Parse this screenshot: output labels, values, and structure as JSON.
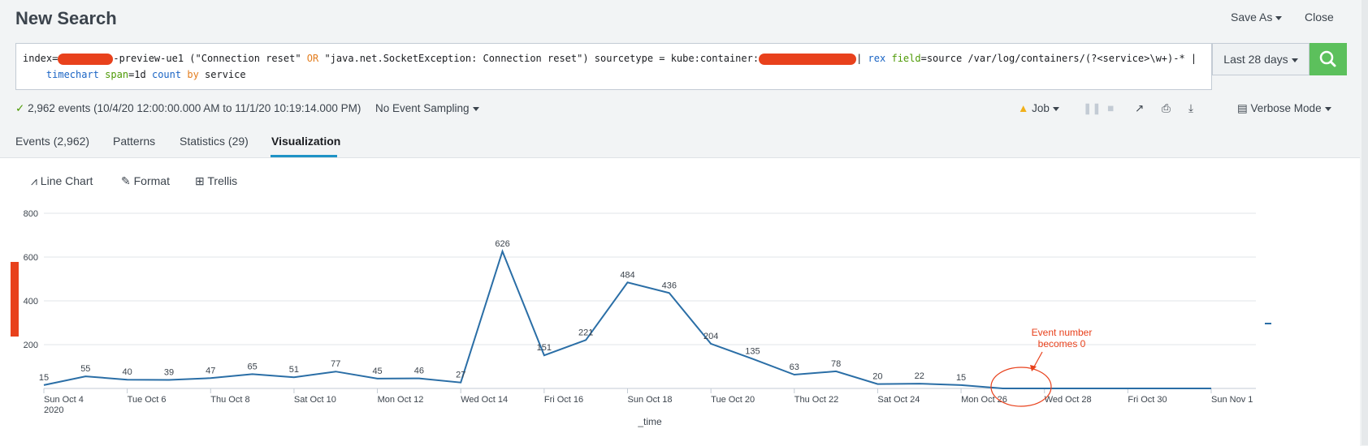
{
  "header": {
    "title": "New Search",
    "save_as_label": "Save As",
    "close_label": "Close"
  },
  "search": {
    "query_parts": {
      "p1": "index=",
      "p2": "-preview-ue1 (\"Connection reset\" ",
      "or": "OR",
      "p3": " \"java.net.SocketException: Connection reset\") sourcetype = kube:container:",
      "pipe1": "| ",
      "rex": "rex",
      "sp": " ",
      "field": "field",
      "p4": "=source /var/log/containers/(?<service>\\w+)-* |",
      "indent": "    ",
      "timechart": "timechart",
      "sp2": " ",
      "span": "span",
      "p5": "=1d ",
      "count": "count",
      "sp3": " ",
      "by": "by",
      "p6": " service"
    },
    "time_range_label": "Last 28 days"
  },
  "status_bar": {
    "events_summary": "2,962 events (10/4/20 12:00:00.000 AM to 11/1/20 10:19:14.000 PM)",
    "sampling_label": "No Event Sampling",
    "job_label": "Job",
    "mode_label": "Verbose Mode"
  },
  "tabs": [
    {
      "label": "Events (2,962)"
    },
    {
      "label": "Patterns"
    },
    {
      "label": "Statistics (29)"
    },
    {
      "label": "Visualization"
    }
  ],
  "viz_toolbar": {
    "line_chart_label": "Line Chart",
    "format_label": "Format",
    "trellis_label": "Trellis"
  },
  "annotation": {
    "line1": "Event number",
    "line2": "becomes 0"
  },
  "colors": {
    "accent_blue": "#2a6ea6",
    "go_green": "#5cc05c",
    "annotation_red": "#e8411c",
    "tab_underline": "#1e93c6"
  },
  "chart_data": {
    "type": "line",
    "xlabel": "_time",
    "ylabel": "",
    "ylim": [
      0,
      800
    ],
    "y_ticks": [
      200,
      400,
      600,
      800
    ],
    "x": [
      "2020-10-04",
      "2020-10-05",
      "2020-10-06",
      "2020-10-07",
      "2020-10-08",
      "2020-10-09",
      "2020-10-10",
      "2020-10-11",
      "2020-10-12",
      "2020-10-13",
      "2020-10-14",
      "2020-10-15",
      "2020-10-16",
      "2020-10-17",
      "2020-10-18",
      "2020-10-19",
      "2020-10-20",
      "2020-10-21",
      "2020-10-22",
      "2020-10-23",
      "2020-10-24",
      "2020-10-25",
      "2020-10-26",
      "2020-10-27",
      "2020-10-28",
      "2020-10-29",
      "2020-10-30",
      "2020-10-31",
      "2020-11-01"
    ],
    "x_tick_labels": [
      "Sun Oct 4",
      "Tue Oct 6",
      "Thu Oct 8",
      "Sat Oct 10",
      "Mon Oct 12",
      "Wed Oct 14",
      "Fri Oct 16",
      "Sun Oct 18",
      "Tue Oct 20",
      "Thu Oct 22",
      "Sat Oct 24",
      "Mon Oct 26",
      "Wed Oct 28",
      "Fri Oct 30",
      "Sun Nov 1"
    ],
    "x_year_label": "2020",
    "series": [
      {
        "values": [
          15,
          55,
          40,
          39,
          47,
          65,
          51,
          77,
          45,
          46,
          27,
          626,
          151,
          221,
          484,
          436,
          204,
          135,
          63,
          78,
          20,
          22,
          15,
          0,
          0,
          0,
          0,
          0,
          0
        ],
        "labels": [
          "15",
          "55",
          "40",
          "39",
          "47",
          "65",
          "51",
          "77",
          "45",
          "46",
          "27",
          "626",
          "151",
          "221",
          "484",
          "436",
          "204",
          "135",
          "63",
          "78",
          "20",
          "22",
          "15",
          "",
          "",
          "",
          "",
          "",
          ""
        ]
      }
    ],
    "grid": true,
    "legend": "none"
  }
}
